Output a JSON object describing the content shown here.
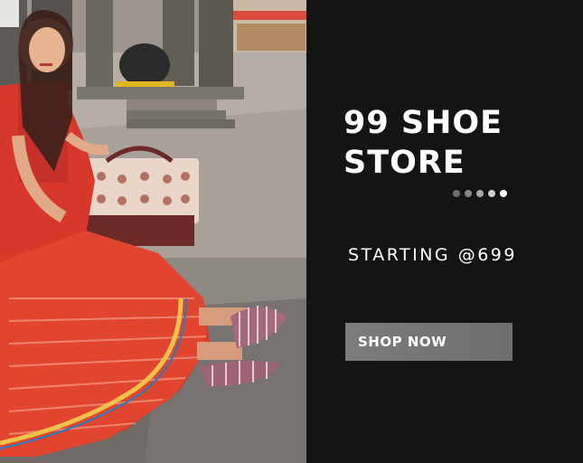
{
  "banner": {
    "title_line1": "99 SHOE",
    "title_line2": "STORE",
    "subtitle": "STARTING @699",
    "cta_label": "SHOP NOW"
  },
  "photo": {
    "description_icon": "photo-icon"
  },
  "colors": {
    "panel_bg": "#141414",
    "text": "#ffffff",
    "cta_bg": "#787878",
    "dress_red": "#d8382a",
    "shoe_stripe": "#9a6a7a"
  },
  "carousel": {
    "dots": 5,
    "active": 5
  }
}
